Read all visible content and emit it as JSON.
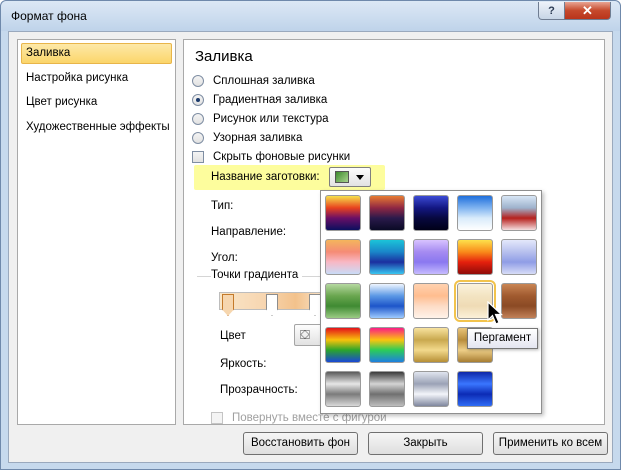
{
  "window": {
    "title": "Формат фона",
    "help_label": "?",
    "close_label": "✕"
  },
  "sidebar": {
    "items": [
      {
        "label": "Заливка",
        "selected": true
      },
      {
        "label": "Настройка рисунка",
        "selected": false
      },
      {
        "label": "Цвет рисунка",
        "selected": false
      },
      {
        "label": "Художественные эффекты",
        "selected": false
      }
    ]
  },
  "fill": {
    "section_title": "Заливка",
    "options": [
      {
        "label": "Сплошная заливка",
        "checked": false
      },
      {
        "label": "Градиентная заливка",
        "checked": true
      },
      {
        "label": "Рисунок или текстура",
        "checked": false
      },
      {
        "label": "Узорная заливка",
        "checked": false
      }
    ],
    "hide_bg_label": "Скрыть фоновые рисунки",
    "preset_label": "Название заготовки:",
    "type_label": "Тип:",
    "direction_label": "Направление:",
    "angle_label": "Угол:",
    "gradient_stops_label": "Точки градиента",
    "color_label": "Цвет",
    "brightness_label": "Яркость:",
    "transparency_label": "Прозрачность:",
    "rotate_label": "Повернуть вместе с фигурой"
  },
  "gallery": {
    "tooltip": "Пергамент",
    "presets": [
      {
        "name": "preset-1",
        "colors": [
          "#f6e04b",
          "#e8421f",
          "#6a0f66",
          "#0b0f5e"
        ]
      },
      {
        "name": "preset-2",
        "colors": [
          "#e77b32",
          "#8f2743",
          "#2a1a4b",
          "#0a0a25"
        ]
      },
      {
        "name": "preset-3",
        "colors": [
          "#3b4ad4",
          "#131782",
          "#07083f",
          "#000018"
        ]
      },
      {
        "name": "preset-4",
        "colors": [
          "#1f6fdc",
          "#7fb3f0",
          "#d9ebfb",
          "#ffffff"
        ]
      },
      {
        "name": "preset-5",
        "colors": [
          "#d8e6f5",
          "#9eb2cc",
          "#b6211d",
          "#f5dfe0"
        ]
      },
      {
        "name": "preset-6",
        "colors": [
          "#f4b55c",
          "#f58b76",
          "#f8b8c5",
          "#c9dcf7"
        ]
      },
      {
        "name": "preset-7",
        "colors": [
          "#1bc4d8",
          "#1a86c9",
          "#1b2f9f",
          "#38c6f1"
        ]
      },
      {
        "name": "preset-8",
        "colors": [
          "#d8c3ff",
          "#a58bf1",
          "#8a78f0",
          "#c6bbff"
        ]
      },
      {
        "name": "preset-9",
        "colors": [
          "#fde14b",
          "#f98a1a",
          "#e5200d",
          "#8f0b09"
        ]
      },
      {
        "name": "preset-10",
        "colors": [
          "#e4e8fb",
          "#b7c0ee",
          "#8f9de6",
          "#d7dcf7"
        ]
      },
      {
        "name": "preset-11",
        "colors": [
          "#b5d8a0",
          "#6aa64f",
          "#3f8a32",
          "#9ccb85"
        ]
      },
      {
        "name": "preset-12",
        "colors": [
          "#eef5ff",
          "#5b98e5",
          "#1d55c9",
          "#9ecbff"
        ]
      },
      {
        "name": "preset-13",
        "colors": [
          "#ffd2b0",
          "#ffbd8f",
          "#fddcc6",
          "#fff3ea"
        ]
      },
      {
        "name": "preset-14",
        "colors": [
          "#fbf2dc",
          "#f3e4c2",
          "#efdbb5",
          "#fbf1d9"
        ]
      },
      {
        "name": "preset-15",
        "colors": [
          "#c98554",
          "#a05a2f",
          "#8b4a24",
          "#c28159"
        ]
      },
      {
        "name": "preset-16",
        "colors": [
          "#e4121a",
          "#f8c20b",
          "#2ba52b",
          "#1a47d6"
        ]
      },
      {
        "name": "preset-17",
        "colors": [
          "#fa1d85",
          "#fbc40e",
          "#2ccc58",
          "#1e7fe0"
        ]
      },
      {
        "name": "preset-18",
        "colors": [
          "#f7e39f",
          "#c9a84e",
          "#f2d98c",
          "#b78f35"
        ]
      },
      {
        "name": "preset-19",
        "colors": [
          "#e9c57a",
          "#b98d3c",
          "#eecf88",
          "#a77d31"
        ]
      },
      {
        "name": "preset-20",
        "colors": [
          "#ffffff",
          "#ffffff",
          "#ffffff",
          "#ffffff"
        ]
      },
      {
        "name": "preset-21",
        "colors": [
          "#5a5a5a",
          "#e6e6e6",
          "#7b7b7b",
          "#d9d9d9"
        ]
      },
      {
        "name": "preset-22",
        "colors": [
          "#3a3a3a",
          "#d4d4d4",
          "#707070",
          "#bdbdbd"
        ]
      },
      {
        "name": "preset-23",
        "colors": [
          "#e0e5ef",
          "#9ba2b6",
          "#f3f5fa",
          "#7f879e"
        ]
      },
      {
        "name": "preset-24",
        "colors": [
          "#0e28a8",
          "#3a76ff",
          "#0c2bb5",
          "#2f6cf5"
        ]
      }
    ]
  },
  "buttons": {
    "reset_label": "Восстановить фон",
    "close_label": "Закрыть",
    "apply_all_label": "Применить ко всем"
  },
  "colors": {
    "selection": "#fbd56a",
    "preset_highlight": "#fdfd9d",
    "close_red": "#c6492c"
  }
}
